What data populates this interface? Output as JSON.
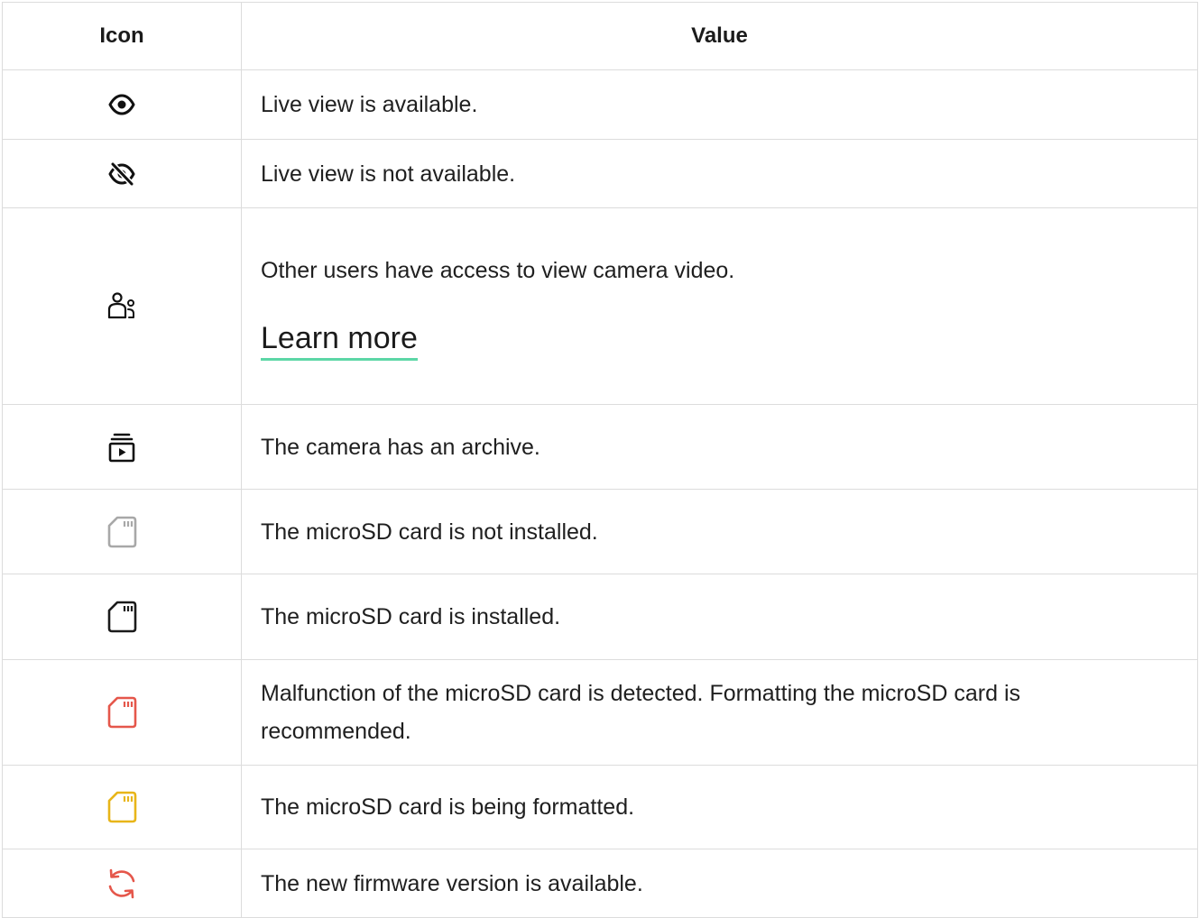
{
  "header": {
    "icon_col": "Icon",
    "value_col": "Value"
  },
  "rows": [
    {
      "icon": "eye-icon",
      "text": "Live view is available."
    },
    {
      "icon": "eye-off-icon",
      "text": "Live view is not available."
    },
    {
      "icon": "shared-users-icon",
      "text": "Other users have access to view camera video.",
      "link": "Learn more"
    },
    {
      "icon": "archive-play-icon",
      "text": "The camera has an archive."
    },
    {
      "icon": "sd-card-grey-icon",
      "text": "The microSD card is not installed.",
      "color": "#a8a8a8"
    },
    {
      "icon": "sd-card-black-icon",
      "text": "The microSD card is installed.",
      "color": "#1b1b1b"
    },
    {
      "icon": "sd-card-red-icon",
      "text": "Malfunction of the microSD card is detected. Formatting the microSD card is recommended.",
      "color": "#e5574b"
    },
    {
      "icon": "sd-card-yellow-icon",
      "text": "The microSD card is being formatted.",
      "color": "#e8b519"
    },
    {
      "icon": "refresh-icon",
      "text": "The new firmware version is available.",
      "color": "#e5574b"
    }
  ],
  "colors": {
    "link_underline": "#5cd6a6",
    "border": "#dcdcdc"
  }
}
